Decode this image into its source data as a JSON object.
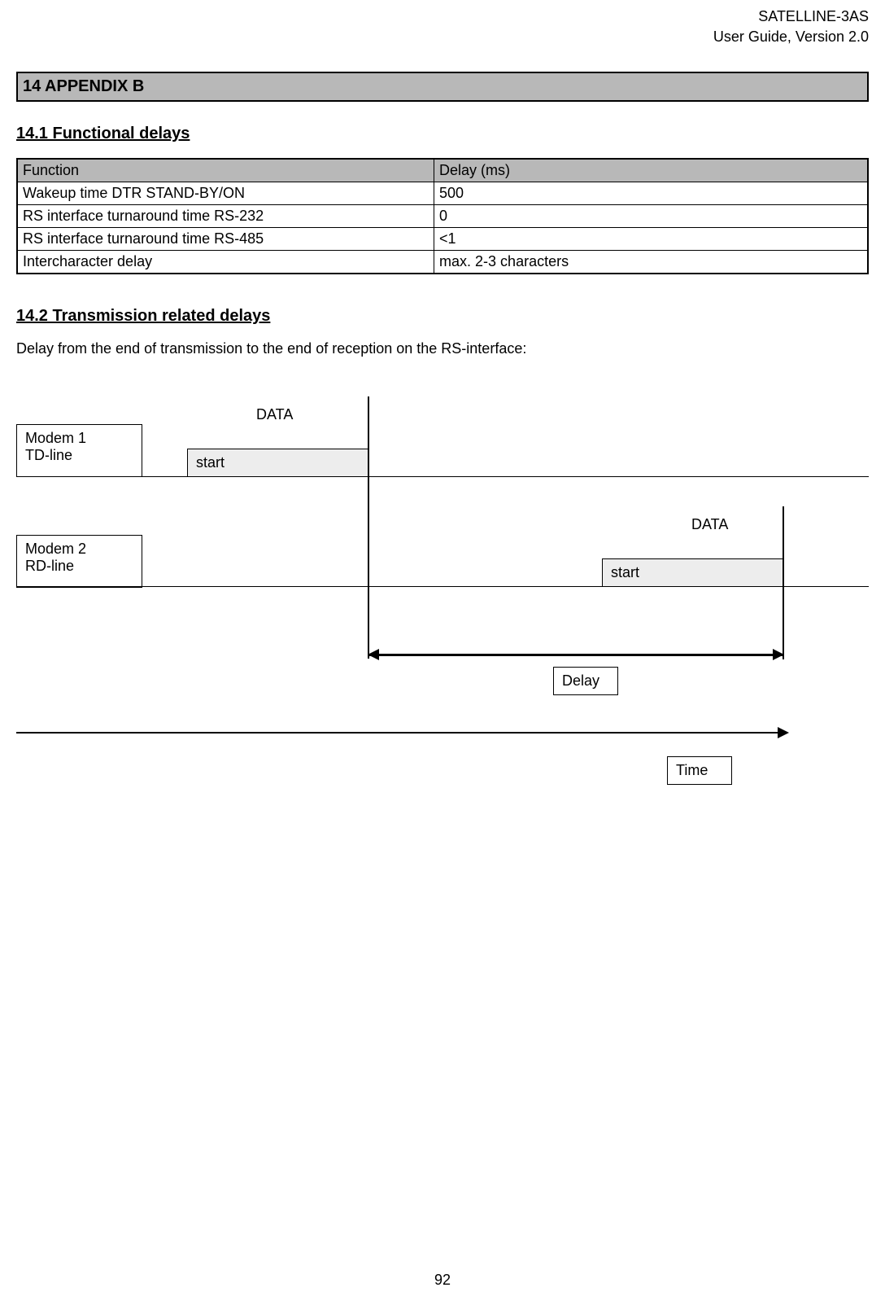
{
  "header": {
    "title1": "SATELLINE-3AS",
    "title2": "User Guide, Version 2.0"
  },
  "section_bar": "14  APPENDIX B",
  "subsection1": "14.1 Functional delays",
  "table": {
    "headers": [
      "Function",
      "Delay (ms)"
    ],
    "rows": [
      [
        "Wakeup time DTR STAND-BY/ON",
        "500"
      ],
      [
        "RS interface turnaround time RS-232",
        "0"
      ],
      [
        "RS interface turnaround time RS-485",
        "<1"
      ],
      [
        "Intercharacter delay",
        "max. 2-3 characters"
      ]
    ]
  },
  "subsection2": "14.2 Transmission related delays",
  "para": "Delay from the end of transmission to the end of reception on the RS-interface:",
  "diagram": {
    "modem1_l1": "Modem 1",
    "modem1_l2": "TD-line",
    "modem2_l1": "Modem 2",
    "modem2_l2": "RD-line",
    "data": "DATA",
    "start": "start",
    "delay": "Delay",
    "time": "Time"
  },
  "page_number": "92"
}
